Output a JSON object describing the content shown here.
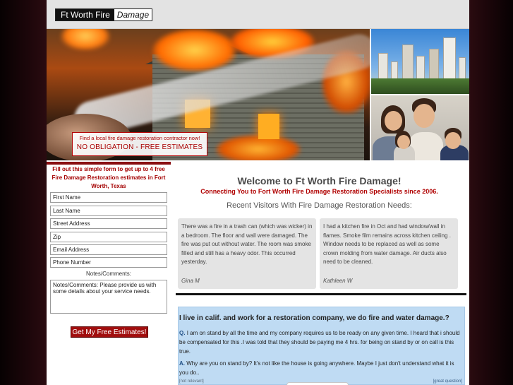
{
  "header": {
    "logo_left": "Ft Worth Fire",
    "logo_right": "Damage"
  },
  "hero": {
    "promo_small": "Find a local fire damage restoration contractor now!",
    "promo_big": "NO OBLIGATION - FREE ESTIMATES"
  },
  "form": {
    "title": "Fill out this simple form to get up to 4 free Fire Damage Restoration estimates in Fort Worth, Texas",
    "fields": {
      "first_name": "First Name",
      "last_name": "Last Name",
      "street": "Street Address",
      "zip": "Zip",
      "email": "Email Address",
      "phone": "Phone Number"
    },
    "notes_label": "Notes/Comments:",
    "notes_value": "Notes/Comments: Please provide us with some details about your service needs.",
    "submit": "Get My Free Estimates!"
  },
  "welcome": {
    "title": "Welcome to Ft Worth Fire Damage!",
    "subtitle": "Connecting You to Fort Worth Fire Damage Restoration Specialists since 2006.",
    "recent": "Recent Visitors With Fire Damage Restoration Needs:"
  },
  "testimonials": [
    {
      "text": "There was a fire in a trash can (which was wicker) in a bedroom. The floor and wall were damaged. The fire was put out without water. The room was smoke filled and still has a heavy odor. This occurred yesterday.",
      "name": "Gina M"
    },
    {
      "text": "I had a kitchen fire in Oct and had window/wall in flames. Smoke film remains across kitchen ceiling . Window needs to be replaced as well as some crown molding from water damage. Air ducts also need to be cleaned.",
      "name": "Kathleen W"
    }
  ],
  "qa": {
    "title": "I live in calif. and work for a restoration company, we do fire and water damage.?",
    "q_label": "Q.",
    "q_text": "I am on stand by all the time and my company requires us to be ready on any given time. I heard that i should be compensated for this .I was told that they should be paying me 4 hrs. for being on stand by or on call is this true.",
    "a_label": "A.",
    "a_text": "Why are you on stand by? It's not like the house is going anywhere. Maybe I just don't understand what it is you do..",
    "not_relevant": "[not relevant]",
    "great_question": "[great question]"
  }
}
